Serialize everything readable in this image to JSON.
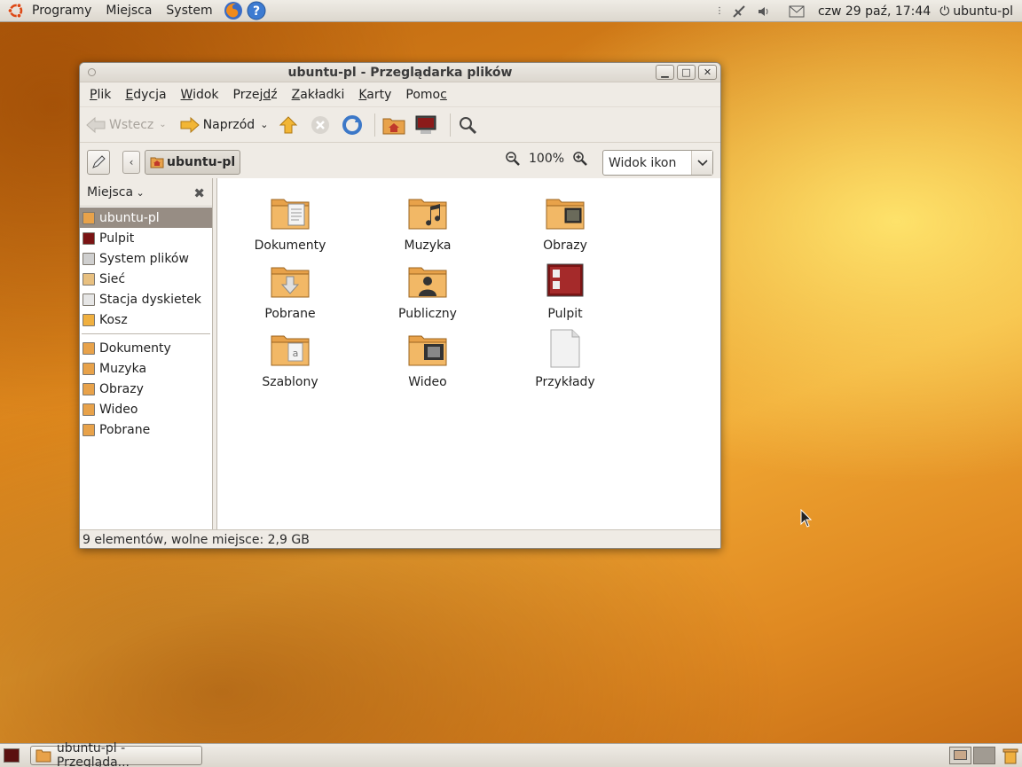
{
  "top_panel": {
    "menus": [
      "Programy",
      "Miejsca",
      "System"
    ],
    "clock": "czw 29 paź, 17:44",
    "user": "ubuntu-pl"
  },
  "window": {
    "title": "ubuntu-pl - Przeglądarka plików",
    "menubar": [
      "Plik",
      "Edycja",
      "Widok",
      "Przejdź",
      "Zakładki",
      "Karty",
      "Pomoc"
    ],
    "toolbar": {
      "back_label": "Wstecz",
      "forward_label": "Naprzód"
    },
    "location": {
      "crumb": "ubuntu-pl",
      "zoom": "100%",
      "view_mode": "Widok ikon"
    },
    "sidebar": {
      "header": "Miejsca",
      "places": [
        {
          "label": "ubuntu-pl",
          "icon": "home-folder-icon",
          "selected": true
        },
        {
          "label": "Pulpit",
          "icon": "desktop-icon"
        },
        {
          "label": "System plików",
          "icon": "filesystem-icon"
        },
        {
          "label": "Sieć",
          "icon": "network-icon"
        },
        {
          "label": "Stacja dyskietek",
          "icon": "floppy-icon"
        },
        {
          "label": "Kosz",
          "icon": "trash-icon"
        }
      ],
      "bookmarks": [
        {
          "label": "Dokumenty",
          "icon": "documents-folder-icon"
        },
        {
          "label": "Muzyka",
          "icon": "music-folder-icon"
        },
        {
          "label": "Obrazy",
          "icon": "pictures-folder-icon"
        },
        {
          "label": "Wideo",
          "icon": "video-folder-icon"
        },
        {
          "label": "Pobrane",
          "icon": "downloads-folder-icon"
        }
      ]
    },
    "files": [
      {
        "label": "Dokumenty",
        "icon": "documents-folder-icon"
      },
      {
        "label": "Muzyka",
        "icon": "music-folder-icon"
      },
      {
        "label": "Obrazy",
        "icon": "pictures-folder-icon"
      },
      {
        "label": "Pobrane",
        "icon": "downloads-folder-icon"
      },
      {
        "label": "Publiczny",
        "icon": "public-folder-icon"
      },
      {
        "label": "Pulpit",
        "icon": "desktop-folder-icon"
      },
      {
        "label": "Szablony",
        "icon": "templates-folder-icon"
      },
      {
        "label": "Wideo",
        "icon": "video-folder-icon"
      },
      {
        "label": "Przykłady",
        "icon": "file-icon"
      }
    ],
    "status": "9 elementów, wolne miejsce: 2,9 GB"
  },
  "bottom_panel": {
    "task_label": "ubuntu-pl - Przegląda..."
  },
  "colors": {
    "folder": "#e8a24a",
    "selection": "#978d84",
    "panel": "#e6e2db"
  }
}
